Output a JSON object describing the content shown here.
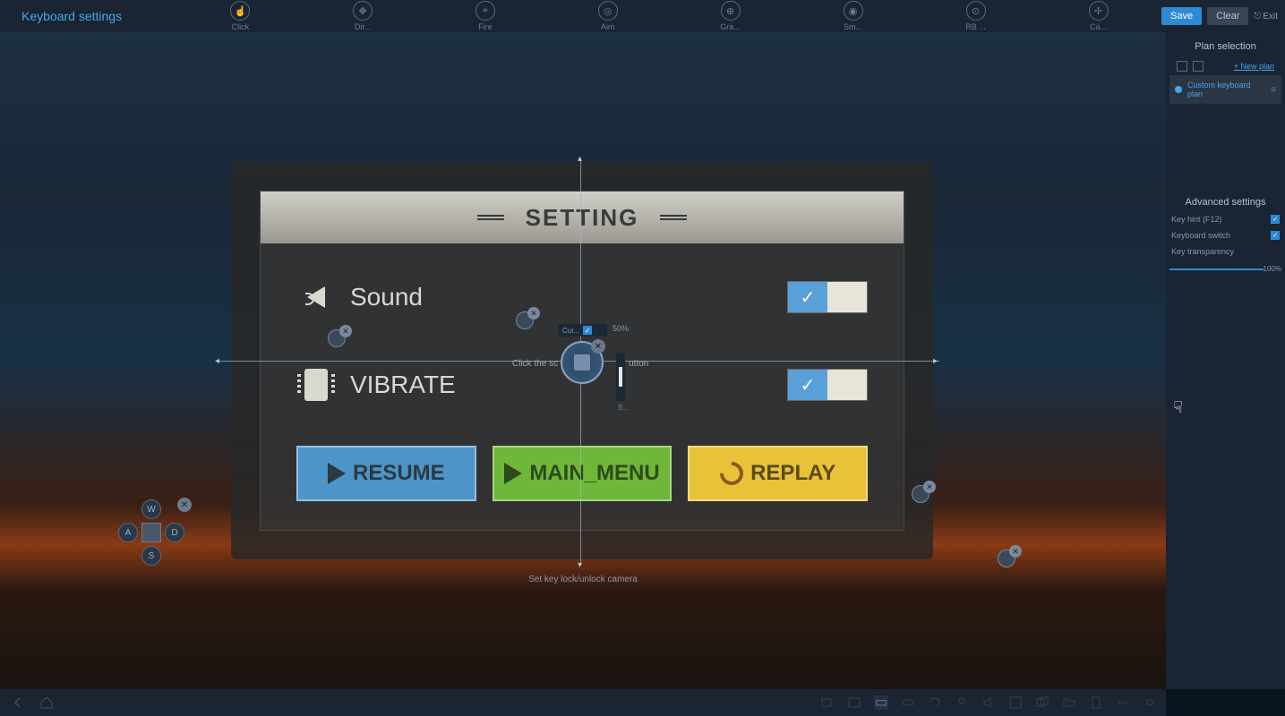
{
  "header": {
    "title": "Keyboard settings",
    "tools": [
      {
        "label": "Click"
      },
      {
        "label": "Dir..."
      },
      {
        "label": "Fire"
      },
      {
        "label": "Aim"
      },
      {
        "label": "Gra..."
      },
      {
        "label": "Sm..."
      },
      {
        "label": "RB ..."
      },
      {
        "label": "Ca..."
      }
    ],
    "save": "Save",
    "clear": "Clear",
    "exit": "Exit"
  },
  "game_panel": {
    "title": "SETTING",
    "rows": [
      {
        "label": "Sound",
        "checked": true
      },
      {
        "label": "VIBRATE",
        "checked": true
      }
    ],
    "buttons": {
      "resume": "RESUME",
      "main_menu": "MAIN_MENU",
      "replay": "REPLAY"
    }
  },
  "aim_control": {
    "cur_label": "Cur...",
    "speed_pct": "50%",
    "slider_label": "S...",
    "hint_left": "Click the sc",
    "hint_right": "utton",
    "camera_hint": "Set key lock/unlock camera"
  },
  "dpad": {
    "w": "W",
    "a": "A",
    "s": "S",
    "d": "D"
  },
  "right_panel": {
    "plan_selection": "Plan selection",
    "new_plan": "+ New plan",
    "plan_name": "Custom keyboard plan",
    "advanced": "Advanced settings",
    "key_hint": "Key hint (F12)",
    "keyboard_switch": "Keyboard switch",
    "key_transparency": "Key transparency",
    "transparency_value": "100%"
  }
}
